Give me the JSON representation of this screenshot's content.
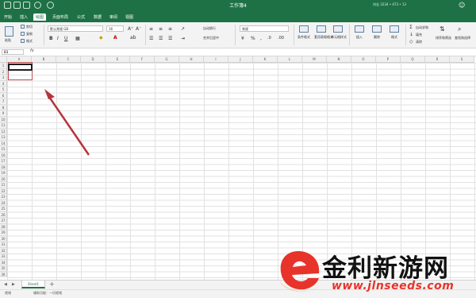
{
  "window": {
    "title": "工作簿4",
    "account": "刘志 3234 • 473 • 13"
  },
  "tabs": [
    "开始",
    "插入",
    "绘图",
    "页面布局",
    "公式",
    "数据",
    "审阅",
    "视图"
  ],
  "ribbon": {
    "paste": "粘贴",
    "cut": "剪切",
    "copy": "复制",
    "format_painter": "格式",
    "font_name": "默认常规 GB",
    "font_size": "16",
    "wrap_text": "自动换行",
    "merge_center": "合并后居中",
    "number_format": "常规",
    "conditional_format": "条件格式",
    "format_as_table": "套用表格格式",
    "cell_styles": "单元格样式",
    "insert": "插入",
    "delete": "删除",
    "format": "格式",
    "autosum": "自动求和",
    "fill": "填充",
    "clear": "清除",
    "sort_filter": "排序和筛选",
    "find_select": "查找和选择"
  },
  "formula_bar": {
    "name_box": "B3",
    "fx": "fx"
  },
  "columns": [
    "A",
    "B",
    "C",
    "D",
    "E",
    "F",
    "G",
    "H",
    "I",
    "J",
    "K",
    "L",
    "M",
    "N",
    "O",
    "P",
    "Q",
    "R",
    "S"
  ],
  "rows": [
    "1",
    "2",
    "3",
    "4",
    "5",
    "6",
    "7",
    "8",
    "9",
    "10",
    "11",
    "12",
    "13",
    "14",
    "15",
    "16",
    "17",
    "18",
    "19",
    "20",
    "21",
    "22",
    "23",
    "24",
    "25",
    "26",
    "27",
    "28",
    "29",
    "30",
    "31",
    "32",
    "33",
    "34",
    "35",
    "36"
  ],
  "sheets": [
    "Sheet1"
  ],
  "status": {
    "ready": "就绪",
    "accessibility": "辅助功能：一切就绪"
  },
  "watermark": {
    "brand": "金利新游网",
    "url": "www.jlnseeds.com"
  },
  "colors": {
    "brand_green": "#1e7145",
    "annotation_red": "#b5343c",
    "watermark_red": "#e8332a"
  }
}
